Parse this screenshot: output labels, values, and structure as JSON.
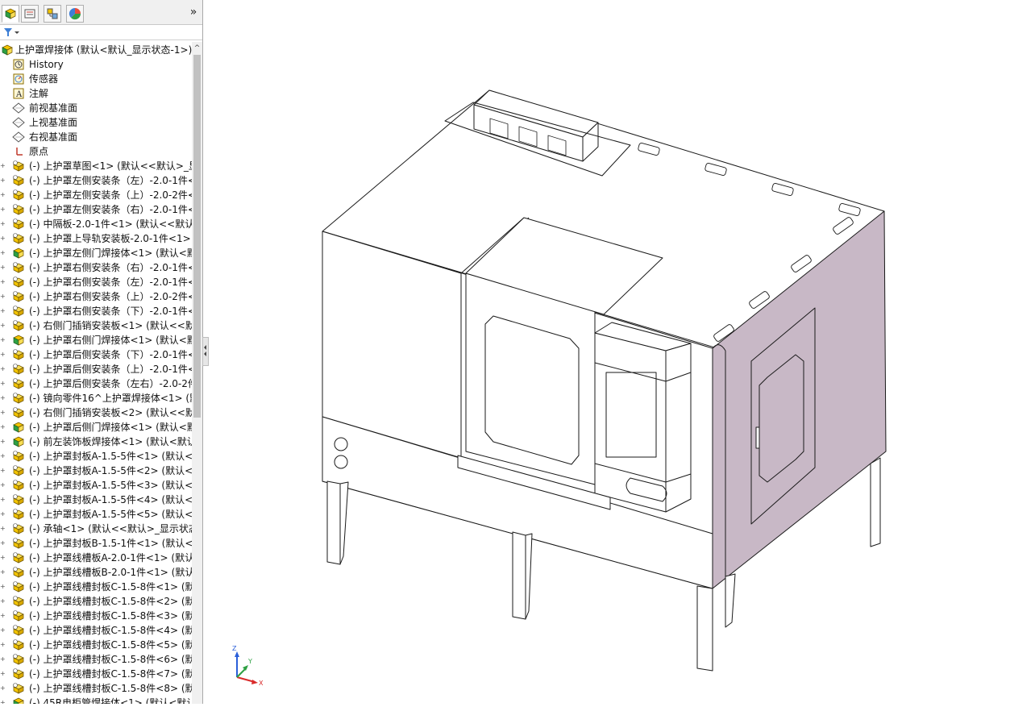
{
  "feature_tree": {
    "root_label": "上护罩焊接体  (默认<默认_显示状态-1>)",
    "items": [
      {
        "label": "History",
        "icon": "history-icon",
        "expand": false,
        "indent": 1
      },
      {
        "label": "传感器",
        "icon": "sensor-icon",
        "expand": false,
        "indent": 1
      },
      {
        "label": "注解",
        "icon": "annotation-icon",
        "expand": false,
        "indent": 1
      },
      {
        "label": "前视基准面",
        "icon": "plane-icon",
        "expand": false,
        "indent": 1
      },
      {
        "label": "上视基准面",
        "icon": "plane-icon",
        "expand": false,
        "indent": 1
      },
      {
        "label": "右视基准面",
        "icon": "plane-icon",
        "expand": false,
        "indent": 1
      },
      {
        "label": "原点",
        "icon": "origin-icon",
        "expand": false,
        "indent": 1
      },
      {
        "label": "(-) 上护罩草图<1> (默认<<默认>_显",
        "icon": "part-icon",
        "expand": true
      },
      {
        "label": "(-) 上护罩左侧安装条（左）-2.0-1件<",
        "icon": "part-icon",
        "expand": true
      },
      {
        "label": "(-) 上护罩左侧安装条（上）-2.0-2件<",
        "icon": "part-icon",
        "expand": true
      },
      {
        "label": "(-) 上护罩左侧安装条（右）-2.0-1件<",
        "icon": "part-icon",
        "expand": true
      },
      {
        "label": "(-) 中隔板-2.0-1件<1> (默认<<默认",
        "icon": "part-icon",
        "expand": true
      },
      {
        "label": "(-) 上护罩上导轨安装板-2.0-1件<1>",
        "icon": "part-icon",
        "expand": true
      },
      {
        "label": "(-) 上护罩左侧门焊接体<1> (默认<默",
        "icon": "assembly-icon",
        "expand": true
      },
      {
        "label": "(-) 上护罩右侧安装条（右）-2.0-1件<",
        "icon": "part-icon",
        "expand": true
      },
      {
        "label": "(-) 上护罩右侧安装条（左）-2.0-1件<",
        "icon": "part-icon",
        "expand": true
      },
      {
        "label": "(-) 上护罩右侧安装条（上）-2.0-2件<",
        "icon": "part-icon",
        "expand": true
      },
      {
        "label": "(-) 上护罩右侧安装条（下）-2.0-1件<",
        "icon": "part-icon",
        "expand": true
      },
      {
        "label": "(-) 右侧门插销安装板<1> (默认<<默",
        "icon": "part-icon",
        "expand": true
      },
      {
        "label": "(-) 上护罩右侧门焊接体<1> (默认<默",
        "icon": "assembly-icon",
        "expand": true
      },
      {
        "label": "(-) 上护罩后侧安装条（下）-2.0-1件<",
        "icon": "part-icon",
        "expand": true
      },
      {
        "label": "(-) 上护罩后侧安装条（上）-2.0-1件<",
        "icon": "part-icon",
        "expand": true
      },
      {
        "label": "(-) 上护罩后侧安装条（左右）-2.0-2件",
        "icon": "part-icon",
        "expand": true
      },
      {
        "label": "(-) 镜向零件16^上护罩焊接体<1> (默",
        "icon": "part-icon",
        "expand": true
      },
      {
        "label": "(-) 右侧门插销安装板<2> (默认<<默",
        "icon": "part-icon",
        "expand": true
      },
      {
        "label": "(-) 上护罩后侧门焊接体<1> (默认<默",
        "icon": "assembly-icon",
        "expand": true
      },
      {
        "label": "(-) 前左装饰板焊接体<1> (默认<默认",
        "icon": "assembly-icon",
        "expand": true
      },
      {
        "label": "(-) 上护罩封板A-1.5-5件<1> (默认<",
        "icon": "part-icon",
        "expand": true
      },
      {
        "label": "(-) 上护罩封板A-1.5-5件<2> (默认<",
        "icon": "part-icon",
        "expand": true
      },
      {
        "label": "(-) 上护罩封板A-1.5-5件<3> (默认<",
        "icon": "part-icon",
        "expand": true
      },
      {
        "label": "(-) 上护罩封板A-1.5-5件<4> (默认<",
        "icon": "part-icon",
        "expand": true
      },
      {
        "label": "(-) 上护罩封板A-1.5-5件<5> (默认<",
        "icon": "part-icon",
        "expand": true
      },
      {
        "label": "(-) 承轴<1> (默认<<默认>_显示状态",
        "icon": "part-icon",
        "expand": true
      },
      {
        "label": "(-) 上护罩封板B-1.5-1件<1> (默认<",
        "icon": "part-icon",
        "expand": true
      },
      {
        "label": "(-) 上护罩线槽板A-2.0-1件<1> (默认",
        "icon": "part-icon",
        "expand": true
      },
      {
        "label": "(-) 上护罩线槽板B-2.0-1件<1> (默认",
        "icon": "part-icon",
        "expand": true
      },
      {
        "label": "(-) 上护罩线槽封板C-1.5-8件<1> (默",
        "icon": "part-icon",
        "expand": true
      },
      {
        "label": "(-) 上护罩线槽封板C-1.5-8件<2> (默",
        "icon": "part-icon",
        "expand": true
      },
      {
        "label": "(-) 上护罩线槽封板C-1.5-8件<3> (默",
        "icon": "part-icon",
        "expand": true
      },
      {
        "label": "(-) 上护罩线槽封板C-1.5-8件<4> (默",
        "icon": "part-icon",
        "expand": true
      },
      {
        "label": "(-) 上护罩线槽封板C-1.5-8件<5> (默",
        "icon": "part-icon",
        "expand": true
      },
      {
        "label": "(-) 上护罩线槽封板C-1.5-8件<6> (默",
        "icon": "part-icon",
        "expand": true
      },
      {
        "label": "(-) 上护罩线槽封板C-1.5-8件<7> (默",
        "icon": "part-icon",
        "expand": true
      },
      {
        "label": "(-) 上护罩线槽封板C-1.5-8件<8> (默",
        "icon": "part-icon",
        "expand": true
      },
      {
        "label": "(-) 45R电柜管焊接体<1> (默认<默认",
        "icon": "assembly-icon",
        "expand": true
      }
    ]
  },
  "triad": {
    "x_label": "X",
    "y_label": "Y",
    "z_label": "Z"
  },
  "colors": {
    "side_panel": "#c8b8c6",
    "edge": "#1a1a1a",
    "part_yellow": "#f2c400",
    "part_green": "#2ea043"
  }
}
